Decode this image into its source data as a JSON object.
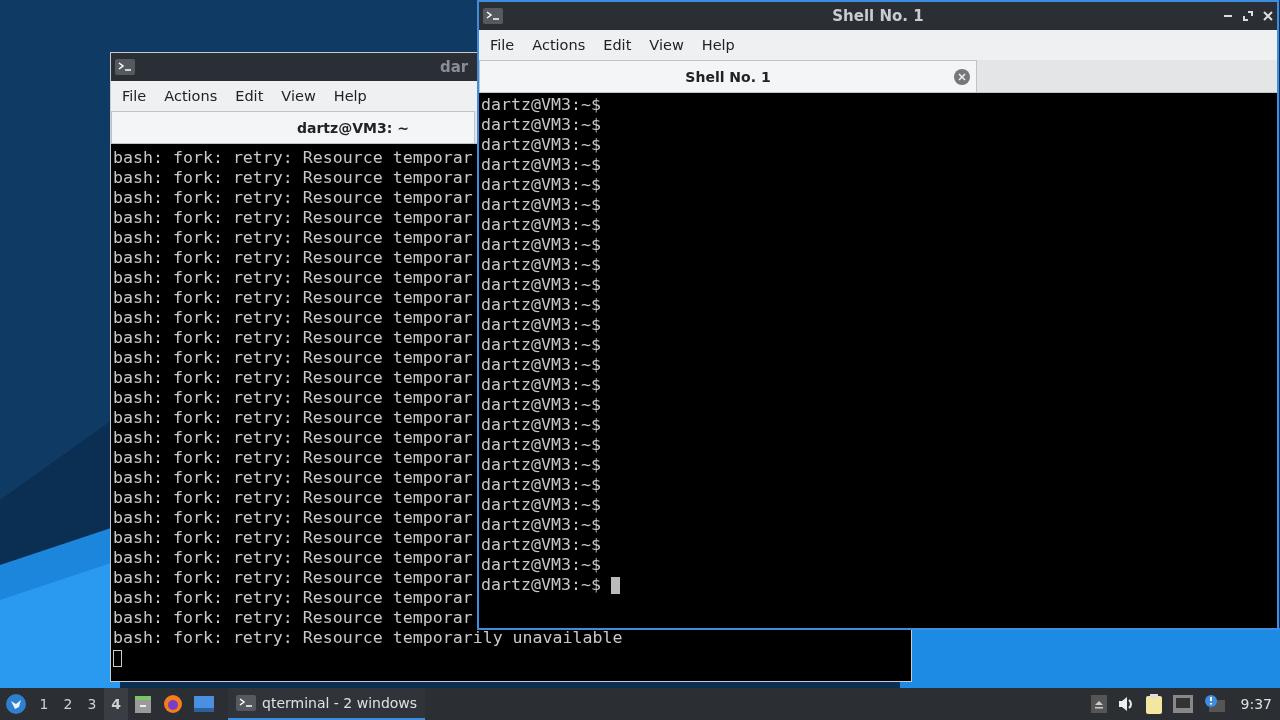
{
  "windows": [
    {
      "title": "dar",
      "focused": false,
      "menu": [
        "File",
        "Actions",
        "Edit",
        "View",
        "Help"
      ],
      "tab": {
        "label": "dartz@VM3: ~",
        "selected": true,
        "closable": false
      },
      "lines": [
        "bash: fork: retry: Resource temporar",
        "bash: fork: retry: Resource temporar",
        "bash: fork: retry: Resource temporar",
        "bash: fork: retry: Resource temporar",
        "bash: fork: retry: Resource temporar",
        "bash: fork: retry: Resource temporar",
        "bash: fork: retry: Resource temporar",
        "bash: fork: retry: Resource temporar",
        "bash: fork: retry: Resource temporar",
        "bash: fork: retry: Resource temporar",
        "bash: fork: retry: Resource temporar",
        "bash: fork: retry: Resource temporar",
        "bash: fork: retry: Resource temporar",
        "bash: fork: retry: Resource temporar",
        "bash: fork: retry: Resource temporar",
        "bash: fork: retry: Resource temporar",
        "bash: fork: retry: Resource temporar",
        "bash: fork: retry: Resource temporar",
        "bash: fork: retry: Resource temporar",
        "bash: fork: retry: Resource temporar",
        "bash: fork: retry: Resource temporar",
        "bash: fork: retry: Resource temporar",
        "bash: fork: retry: Resource temporar",
        "bash: fork: retry: Resource temporar",
        "bash: fork: retry: Resource temporarily unavailable"
      ],
      "controls": false
    },
    {
      "title": "Shell No. 1",
      "focused": true,
      "menu": [
        "File",
        "Actions",
        "Edit",
        "View",
        "Help"
      ],
      "tab": {
        "label": "Shell No. 1",
        "selected": true,
        "closable": true
      },
      "lines": [
        "dartz@VM3:~$",
        "dartz@VM3:~$",
        "dartz@VM3:~$",
        "dartz@VM3:~$",
        "dartz@VM3:~$",
        "dartz@VM3:~$",
        "dartz@VM3:~$",
        "dartz@VM3:~$",
        "dartz@VM3:~$",
        "dartz@VM3:~$",
        "dartz@VM3:~$",
        "dartz@VM3:~$",
        "dartz@VM3:~$",
        "dartz@VM3:~$",
        "dartz@VM3:~$",
        "dartz@VM3:~$",
        "dartz@VM3:~$",
        "dartz@VM3:~$",
        "dartz@VM3:~$",
        "dartz@VM3:~$",
        "dartz@VM3:~$",
        "dartz@VM3:~$",
        "dartz@VM3:~$",
        "dartz@VM3:~$",
        "dartz@VM3:~$ "
      ],
      "controls": true
    }
  ],
  "taskbar": {
    "workspaces": [
      {
        "label": "1",
        "selected": false
      },
      {
        "label": "2",
        "selected": false
      },
      {
        "label": "3",
        "selected": false
      },
      {
        "label": "4",
        "selected": true
      }
    ],
    "tasks": [
      {
        "label": "qterminal - 2 windows",
        "selected": true
      }
    ],
    "clock": "9:37"
  }
}
